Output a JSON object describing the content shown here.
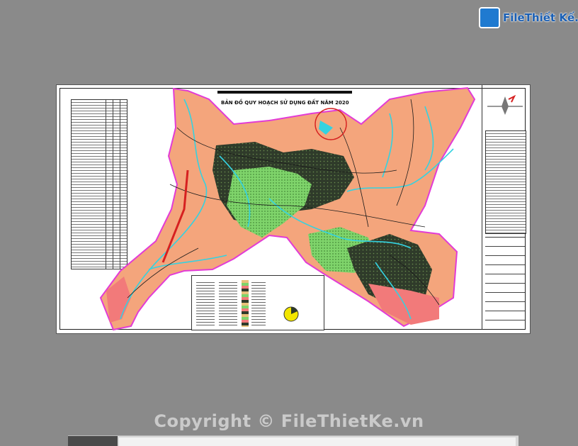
{
  "logo": {
    "text": "FileThiết Kế.vn"
  },
  "map": {
    "title": "BẢN ĐỒ QUY HOẠCH SỬ DỤNG ĐẤT NĂM 2020"
  },
  "watermark": {
    "text": "Copyright © FileThietKe.vn"
  },
  "colors": {
    "background": "#8a8a8a",
    "land": "#f4a57c",
    "forest": "#2f3b2a",
    "green": "#7fd46b",
    "water": "#34d2e0",
    "border": "#e23bd6"
  }
}
